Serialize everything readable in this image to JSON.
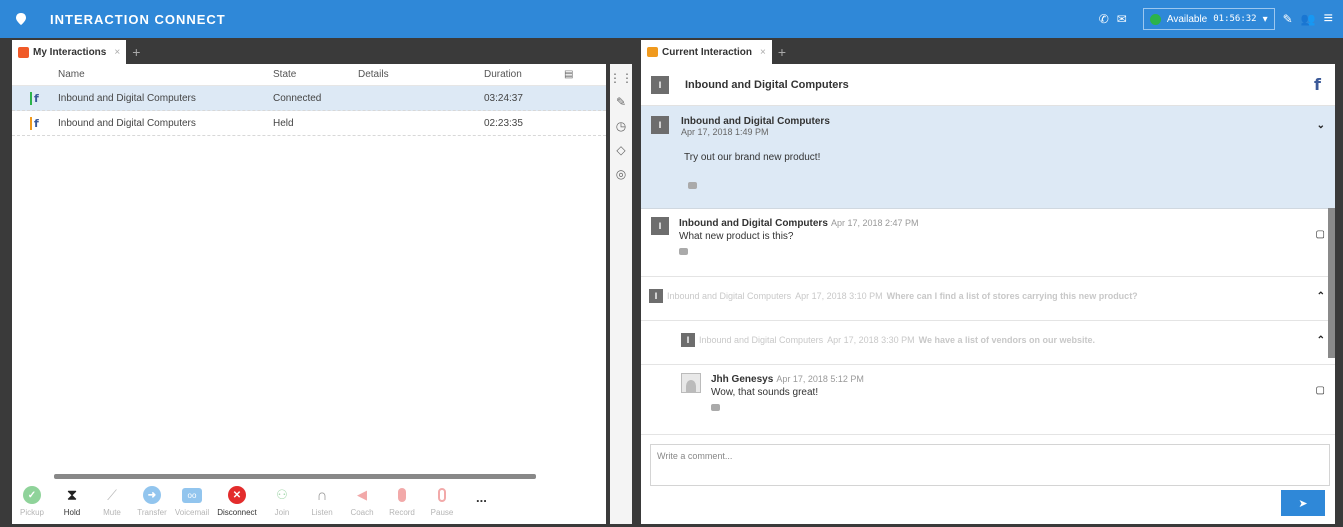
{
  "app": {
    "title": "INTERACTION CONNECT"
  },
  "status": {
    "label": "Available",
    "timer": "01:56:32",
    "color": "#2cb34a"
  },
  "left_tab": {
    "label": "My Interactions"
  },
  "right_tab": {
    "label": "Current Interaction"
  },
  "table": {
    "headers": [
      "Name",
      "State",
      "Details",
      "Duration"
    ],
    "rows": [
      {
        "name": "Inbound and Digital Computers",
        "state": "Connected",
        "details": "",
        "duration": "03:24:37",
        "bar_color": "#2cb34a"
      },
      {
        "name": "Inbound and Digital Computers",
        "state": "Held",
        "details": "",
        "duration": "02:23:35",
        "bar_color": "#f09a1e"
      }
    ]
  },
  "toolbar": {
    "buttons": [
      {
        "label": "Pickup",
        "icon": "check-icon",
        "active": false
      },
      {
        "label": "Hold",
        "icon": "hourglass-icon",
        "active": true
      },
      {
        "label": "Mute",
        "icon": "mute-icon",
        "active": false
      },
      {
        "label": "Transfer",
        "icon": "transfer-icon",
        "active": false
      },
      {
        "label": "Voicemail",
        "icon": "voicemail-icon",
        "active": false
      },
      {
        "label": "Disconnect",
        "icon": "disconnect-icon",
        "active": true
      },
      {
        "label": "Join",
        "icon": "join-icon",
        "active": false
      },
      {
        "label": "Listen",
        "icon": "headphones-icon",
        "active": false
      },
      {
        "label": "Coach",
        "icon": "coach-icon",
        "active": false
      },
      {
        "label": "Record",
        "icon": "microphone-icon",
        "active": false
      },
      {
        "label": "Pause",
        "icon": "pause-record-icon",
        "active": false
      }
    ],
    "more": "..."
  },
  "current": {
    "header_title": "Inbound and Digital Computers",
    "post": {
      "author": "Inbound and Digital Computers",
      "date": "Apr 17, 2018 1:49 PM",
      "message": "Try out our brand new product!"
    },
    "comments": [
      {
        "author": "Inbound and Digital Computers",
        "date": "Apr 17, 2018 2:47 PM",
        "message": "What new product is this?"
      },
      {
        "author": "Inbound and Digital Computers",
        "date": "Apr 17, 2018 3:10 PM",
        "message": "Where can I find a list of stores carrying this new product?"
      },
      {
        "author": "Inbound and Digital Computers",
        "date": "Apr 17, 2018 3:30 PM",
        "message": "We have a list of vendors on our website."
      },
      {
        "author": "Jhh Genesys",
        "date": "Apr 17, 2018 5:12 PM",
        "message": "Wow, that sounds great!"
      }
    ],
    "composer_placeholder": "Write a comment..."
  },
  "colors": {
    "brand": "#2f88d8",
    "disconnect": "#e32c2c",
    "facebook": "#3b5998"
  }
}
